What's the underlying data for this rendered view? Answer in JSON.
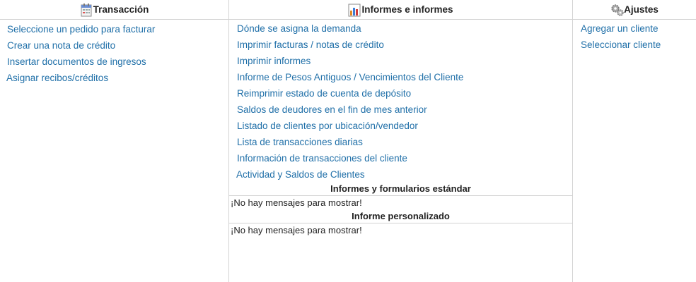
{
  "transaccion": {
    "title": "Transacción",
    "icon": "calendar-icon",
    "links": [
      "Seleccione un pedido para facturar",
      "Crear una nota de crédito",
      "Insertar documentos de ingresos",
      "Asignar recibos/créditos"
    ]
  },
  "informes": {
    "title": "Informes e informes",
    "icon": "bar-chart-icon",
    "links": [
      "Dónde se asigna la demanda",
      "Imprimir facturas / notas de crédito",
      "Imprimir informes",
      "Informe de Pesos Antiguos / Vencimientos del Cliente",
      "Reimprimir estado de cuenta de depósito",
      "Saldos de deudores en el fin de mes anterior",
      "Listado de clientes por ubicación/vendedor",
      "Lista de transacciones diarias",
      "Información de transacciones del cliente",
      "Actividad y Saldos de Clientes"
    ],
    "standard_title": "Informes y formularios estándar",
    "standard_message": "¡No hay mensajes para mostrar!",
    "custom_title": "Informe personalizado",
    "custom_message": "¡No hay mensajes para mostrar!"
  },
  "ajustes": {
    "title": "Ajustes",
    "icon": "gears-icon",
    "links": [
      "Agregar un cliente",
      "Seleccionar cliente"
    ]
  },
  "colors": {
    "link": "#1f6fa8",
    "border": "#d3d3d3"
  }
}
